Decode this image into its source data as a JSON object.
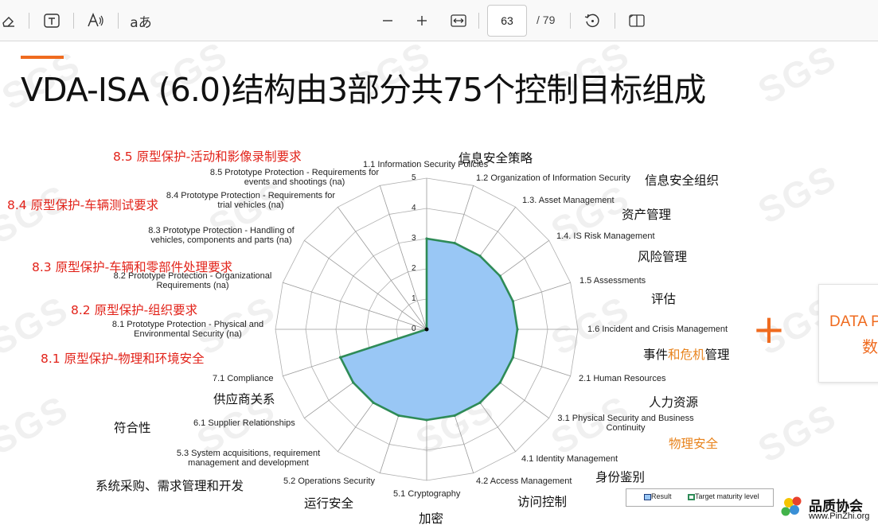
{
  "toolbar": {
    "page_current": "63",
    "page_total": "/ 79",
    "icons": [
      "eraser-icon",
      "text-box-icon",
      "read-aloud-icon",
      "translate-icon",
      "zoom-out-icon",
      "zoom-in-icon",
      "fit-width-icon",
      "rotate-icon",
      "two-page-icon"
    ]
  },
  "slide": {
    "title": "VDA-ISA (6.0)结构由3部分共75个控制目标组成",
    "watermark": "SGS",
    "side_card": {
      "line1": "DATA P",
      "line2": "数"
    },
    "logo": {
      "name": "品质协会",
      "url": "www.PinZhi.org"
    },
    "legend": {
      "result": "Result",
      "target": "Target maturity level"
    }
  },
  "chart_data": {
    "type": "radar",
    "axis_ticks": [
      "0",
      "1",
      "2",
      "3",
      "4",
      "5"
    ],
    "rlim": [
      0,
      5
    ],
    "categories": [
      {
        "en": "1.1 Information Security Policies",
        "zh": "信息安全策略",
        "value": 3
      },
      {
        "en": "1.2 Organization of Information Security",
        "zh": "信息安全组织",
        "value": 3
      },
      {
        "en": "1.3. Asset Management",
        "zh": "资产管理",
        "value": 3
      },
      {
        "en": "1.4. IS Risk Management",
        "zh": "风险管理",
        "value": 3
      },
      {
        "en": "1.5 Assessments",
        "zh": "评估",
        "value": 3
      },
      {
        "en": "1.6 Incident and Crisis Management",
        "zh_parts": [
          "事件",
          "和危机",
          "管理"
        ],
        "value": 3
      },
      {
        "en": "2.1 Human Resources",
        "zh": "人力资源",
        "value": 3
      },
      {
        "en": "3.1 Physical Security and Business Continuity",
        "zh": "物理安全",
        "value": 3
      },
      {
        "en": "4.1 Identity Management",
        "zh": "身份鉴别",
        "value": 3
      },
      {
        "en": "4.2 Access Management",
        "zh": "访问控制",
        "value": 3
      },
      {
        "en": "5.1 Cryptography",
        "zh": "加密",
        "value": 3
      },
      {
        "en": "5.2 Operations Security",
        "zh": "运行安全",
        "value": 3
      },
      {
        "en": "5.3 System acquisitions, requirement management and development",
        "zh": "系统采购、需求管理和开发",
        "value": 3
      },
      {
        "en": "6.1 Supplier Relationships",
        "zh": "供应商关系",
        "value": 3
      },
      {
        "en": "7.1 Compliance",
        "zh": "符合性",
        "value": 3
      },
      {
        "en": "8.1 Prototype Protection - Physical and Environmental Security (na)",
        "zh": "8.1 原型保护-物理和环境安全",
        "value": 0
      },
      {
        "en": "8.2 Prototype Protection - Organizational Requirements (na)",
        "zh": "8.2 原型保护-组织要求",
        "value": 0
      },
      {
        "en": "8.3 Prototype Protection - Handling of vehicles, components and parts (na)",
        "zh": "8.3 原型保护-车辆和零部件处理要求",
        "value": 0
      },
      {
        "en": "8.4 Prototype Protection - Requirements for trial vehicles (na)",
        "zh": "8.4 原型保护-车辆测试要求",
        "value": 0
      },
      {
        "en": "8.5 Prototype Protection - Requirements for events and shootings (na)",
        "zh": "8.5 原型保护-活动和影像录制要求",
        "value": 0
      }
    ],
    "series": [
      {
        "name": "Result",
        "color": "#99c7f5"
      },
      {
        "name": "Target maturity level",
        "color": "#2e8b57"
      }
    ]
  }
}
